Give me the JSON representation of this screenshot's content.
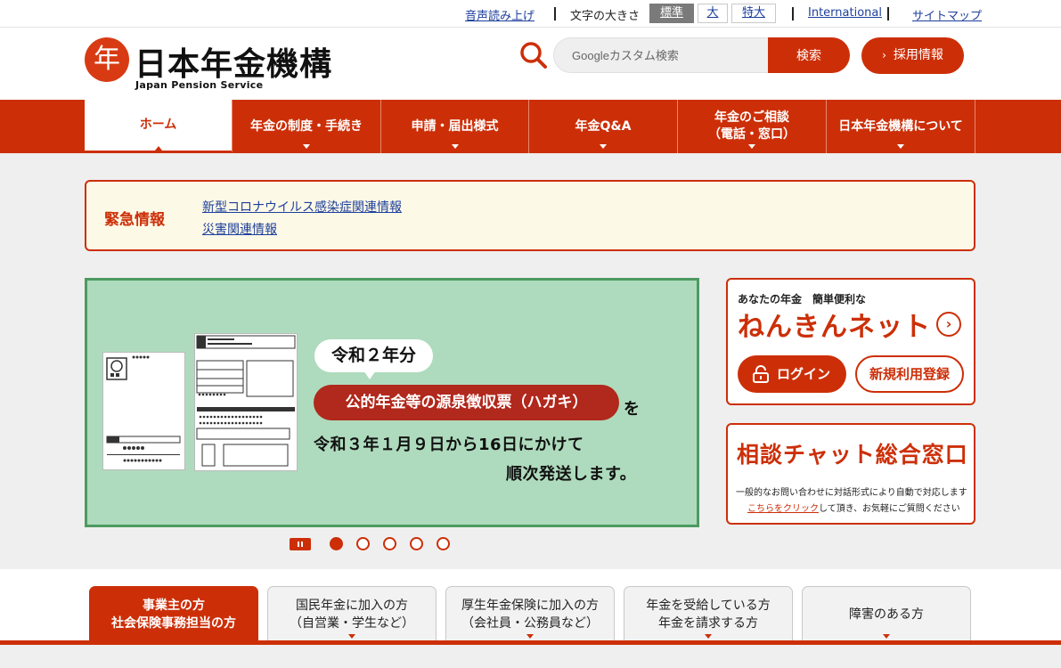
{
  "utility": {
    "voice_read": "音声読み上げ",
    "font_size_label": "文字の大きさ",
    "font_sizes": [
      "標準",
      "大",
      "特大"
    ],
    "international": "International",
    "sitemap": "サイトマップ"
  },
  "header": {
    "logo_mark": "年",
    "logo_title": "日本年金機構",
    "logo_subtitle": "Japan Pension Service",
    "search_placeholder": "Googleカスタム検索",
    "search_button": "検索",
    "recruit_button": "採用情報",
    "recruit_chevron": "›"
  },
  "nav": [
    {
      "label": "ホーム"
    },
    {
      "label": "年金の制度・手続き"
    },
    {
      "label": "申請・届出様式"
    },
    {
      "label": "年金Q&A"
    },
    {
      "label": "年金のご相談\n（電話・窓口）"
    },
    {
      "label": "日本年金機構について"
    }
  ],
  "emergency": {
    "title": "緊急情報",
    "links": [
      "新型コロナウイルス感染症関連情報",
      "災害関連情報"
    ]
  },
  "carousel": {
    "year_pill": "令和２年分",
    "main_pill": "公的年金等の源泉徴収票（ハガキ）",
    "particle": "を",
    "line1": "令和３年１月９日から16日にかけて",
    "line2": "順次発送します。",
    "slide_count": 5,
    "active_slide": 1
  },
  "nenkin_net": {
    "subtitle": "あなたの年金　簡単便利な",
    "title": "ねんきんネット",
    "arrow": "›",
    "login": "ログイン",
    "register": "新規利用登録"
  },
  "chat": {
    "title": "相談チャット総合窓口",
    "desc1": "一般的なお問い合わせに対話形式により自動で対応します",
    "desc2_link": "こちらをクリック",
    "desc2_rest": "して頂き、お気軽にご質問ください"
  },
  "audience_tabs": [
    {
      "label": "事業主の方\n社会保険事務担当の方"
    },
    {
      "label": "国民年金に加入の方\n（自営業・学生など）"
    },
    {
      "label": "厚生年金保険に加入の方\n（会社員・公務員など）"
    },
    {
      "label": "年金を受給している方\n年金を請求する方"
    },
    {
      "label": "障害のある方"
    }
  ],
  "colors": {
    "brand": "#cc2f08",
    "emergency_bg": "#fdf9e7",
    "carousel_bg": "#aedbbd",
    "link": "#1d3f9c"
  }
}
